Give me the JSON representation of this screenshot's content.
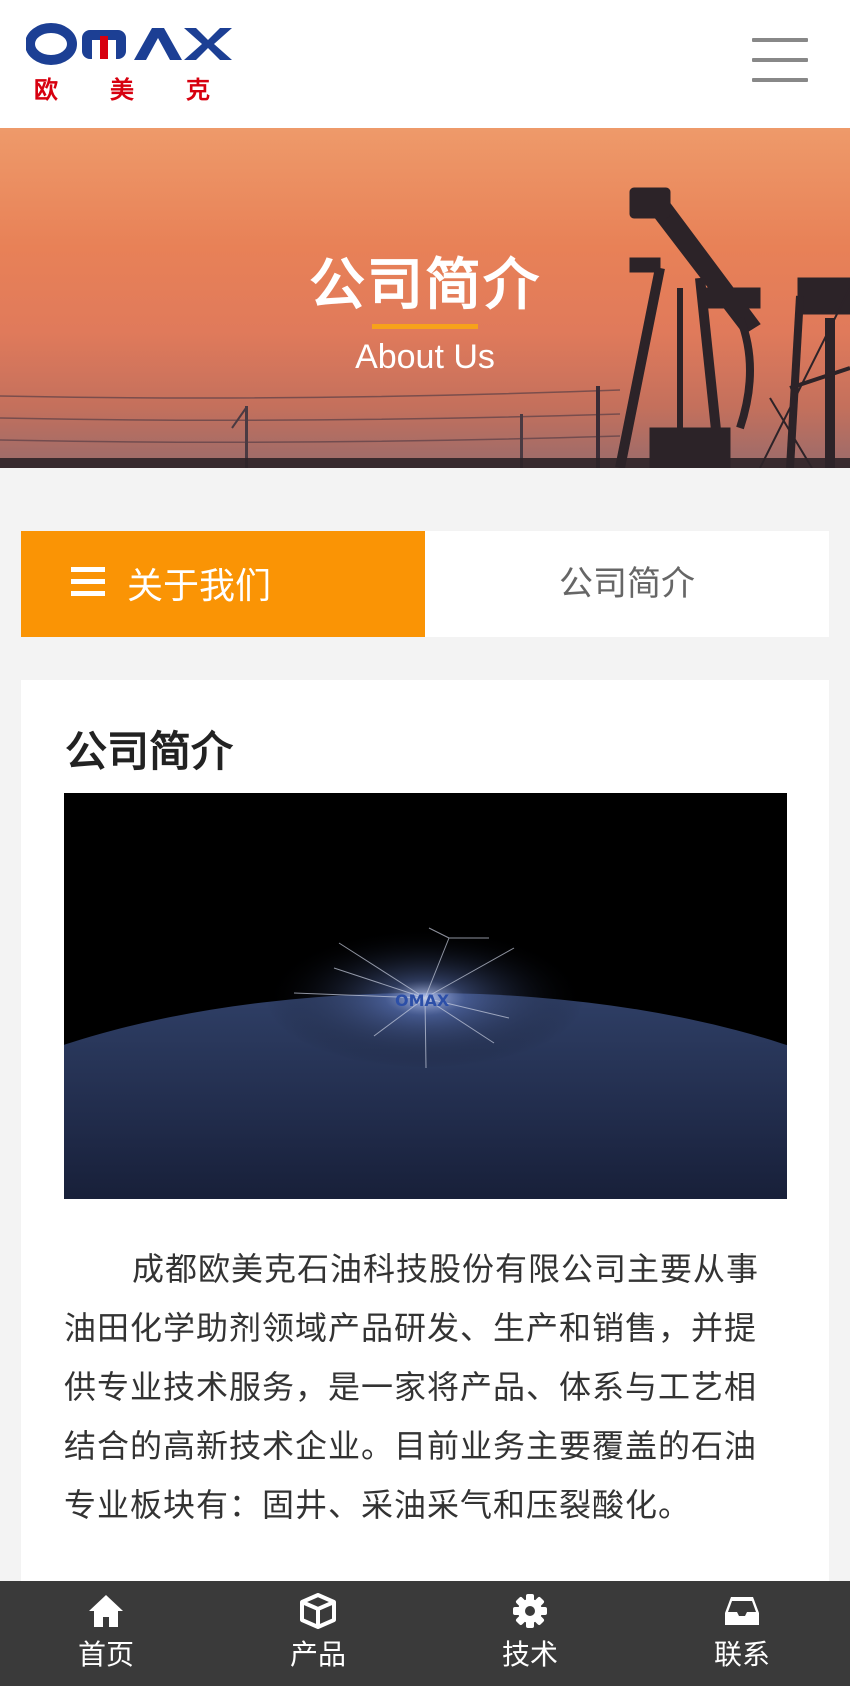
{
  "header": {
    "logo_text": "OMAX",
    "logo_cn": [
      "欧",
      "美",
      "克"
    ],
    "menu_icon": "hamburger-menu-icon"
  },
  "banner": {
    "title": "公司简介",
    "subtitle": "About Us"
  },
  "category": {
    "active_label": "关于我们",
    "current_label": "公司简介"
  },
  "content": {
    "title": "公司简介",
    "intro": "成都欧美克石油科技股份有限公司主要从事油田化学助剂领域产品研发、生产和销售，并提供专业技术服务，是一家将产品、体系与工艺相结合的高新技术企业。目前业务主要覆盖的石油专业板块有：固井、采油采气和压裂酸化。"
  },
  "bottom_nav": {
    "items": [
      {
        "label": "首页",
        "icon": "home-icon"
      },
      {
        "label": "产品",
        "icon": "cube-icon"
      },
      {
        "label": "技术",
        "icon": "gear-icon"
      },
      {
        "label": "联系",
        "icon": "inbox-icon"
      }
    ]
  },
  "colors": {
    "accent": "#fa9405",
    "logo_blue": "#1c3f94",
    "logo_red": "#d7000f",
    "nav_bg": "#3a3a3a"
  }
}
